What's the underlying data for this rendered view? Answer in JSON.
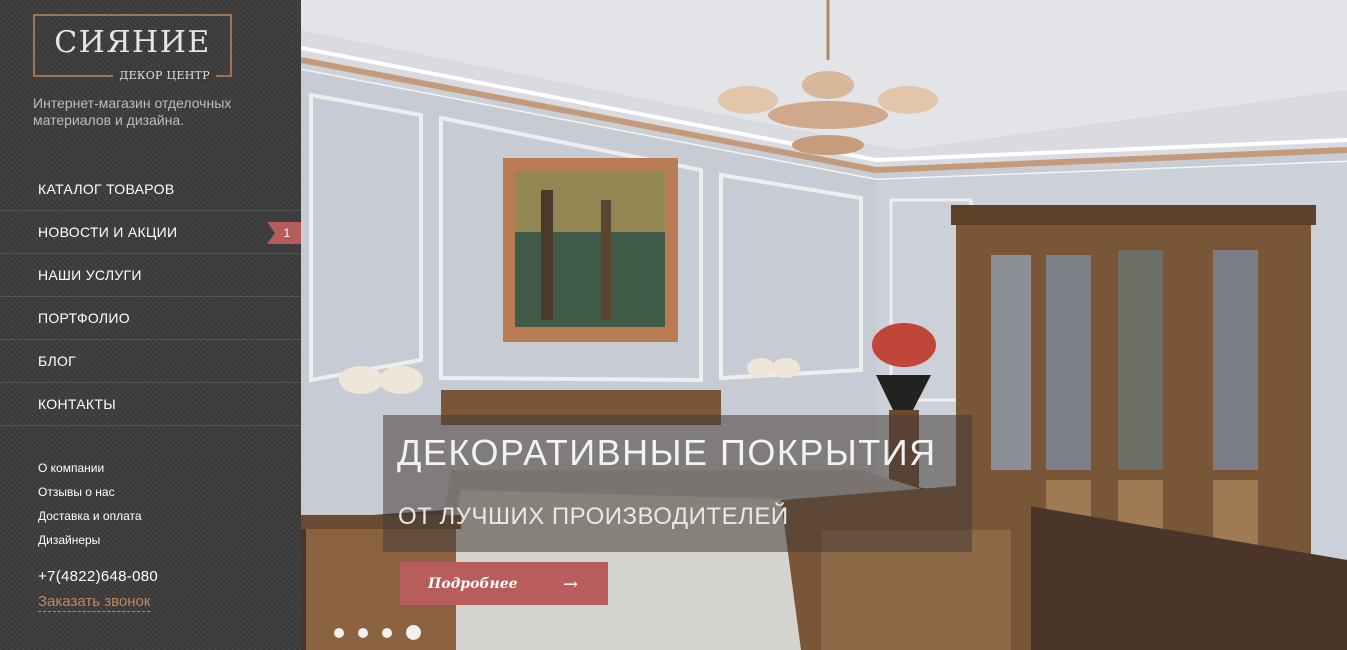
{
  "logo": {
    "title": "СИЯНИЕ",
    "subtitle": "ДЕКОР ЦЕНТР"
  },
  "tagline": "Интернет-магазин отделочных материалов и дизайна.",
  "nav": [
    {
      "label": "КАТАЛОГ ТОВАРОВ"
    },
    {
      "label": "НОВОСТИ И АКЦИИ",
      "badge": "1"
    },
    {
      "label": "НАШИ УСЛУГИ"
    },
    {
      "label": "ПОРТФОЛИО"
    },
    {
      "label": "БЛОГ"
    },
    {
      "label": "КОНТАКТЫ"
    }
  ],
  "sublinks": [
    "О компании",
    "Отзывы о нас",
    "Доставка и оплата",
    "Дизайнеры"
  ],
  "phone": "+7(4822)648-080",
  "callback": "Заказать звонок",
  "slide": {
    "title": "ДЕКОРАТИВНЫЕ ПОКРЫТИЯ",
    "subtitle": "ОТ ЛУЧШИХ ПРОИЗВОДИТЕЛЕЙ",
    "button_label": "Подробнее",
    "button_icon": "arrow-right-icon",
    "slide_count": 4,
    "active_slide": 4
  },
  "colors": {
    "accent": "#b85c5c",
    "logo_border": "#a07452",
    "link": "#c5845e"
  }
}
